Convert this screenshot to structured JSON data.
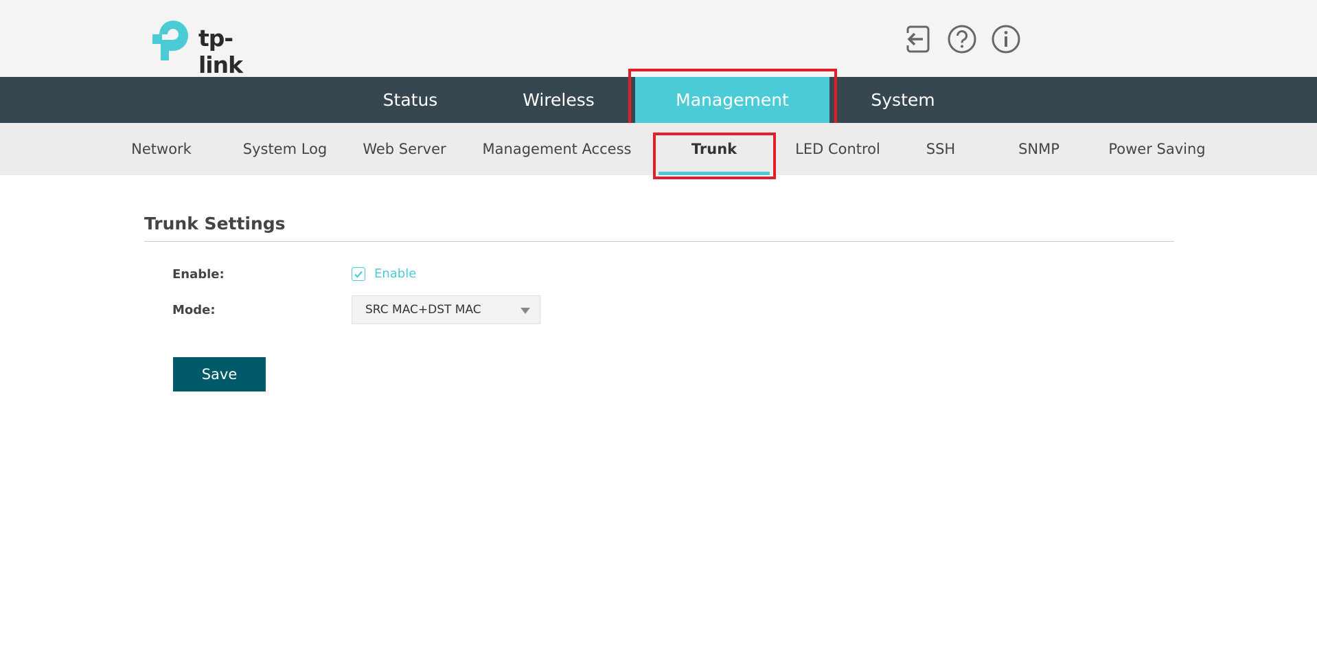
{
  "brand": {
    "logo_text": "tp-link",
    "colors": {
      "accent": "#4acbd6",
      "nav_bg": "#37474f",
      "button_bg": "#005a6a",
      "highlight": "#e31e26"
    }
  },
  "header": {
    "icons": [
      "logout-icon",
      "help-icon",
      "info-icon"
    ]
  },
  "main_nav": {
    "tabs": [
      {
        "label": "Status"
      },
      {
        "label": "Wireless"
      },
      {
        "label": "Management",
        "active": true
      },
      {
        "label": "System"
      }
    ]
  },
  "sub_nav": {
    "tabs": [
      {
        "label": "Network"
      },
      {
        "label": "System Log"
      },
      {
        "label": "Web Server"
      },
      {
        "label": "Management Access"
      },
      {
        "label": "Trunk",
        "active": true
      },
      {
        "label": "LED Control"
      },
      {
        "label": "SSH"
      },
      {
        "label": "SNMP"
      },
      {
        "label": "Power Saving"
      }
    ]
  },
  "trunk": {
    "title": "Trunk Settings",
    "enable_label": "Enable:",
    "enable_checkbox_label": "Enable",
    "enable_checked": true,
    "mode_label": "Mode:",
    "mode_value": "SRC MAC+DST MAC",
    "save_label": "Save"
  }
}
